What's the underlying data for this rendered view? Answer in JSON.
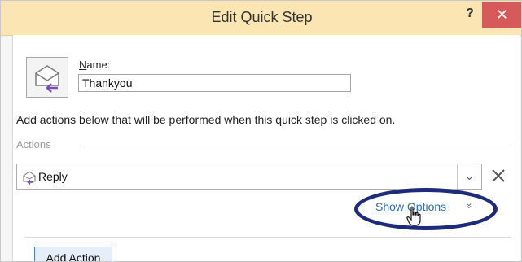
{
  "dialog": {
    "title": "Edit Quick Step",
    "help_symbol": "?",
    "close_symbol": "✕"
  },
  "name_field": {
    "label_accel": "N",
    "label_rest": "ame:",
    "value": "Thankyou"
  },
  "description": "Add actions below that will be performed when this quick step is clicked on.",
  "actions": {
    "section_label": "Actions",
    "items": [
      {
        "label": "Reply",
        "icon": "reply-envelope-icon"
      }
    ],
    "dropdown_symbol": "⌄",
    "remove_symbol": "✕",
    "show_options_label": "Show Options",
    "expand_symbol": "»",
    "add_action_label": "Add Action"
  },
  "colors": {
    "titlebar": "#fbe6b3",
    "close": "#d75a5a",
    "link": "#2e6bb3",
    "highlight": "#1d2b7a"
  }
}
